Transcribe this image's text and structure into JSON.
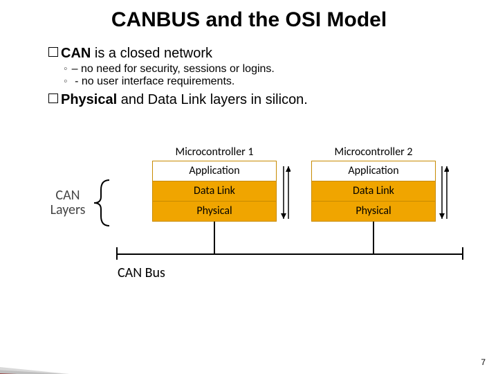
{
  "title": "CANBUS and the OSI Model",
  "bullets": {
    "b1a_prefix": "CAN",
    "b1a_rest": " is a closed network",
    "s1": "– no need for security, sessions or logins.",
    "s2": " - no user interface requirements.",
    "b1b_prefix": "Physical",
    "b1b_rest": " and Data Link layers in silicon."
  },
  "diagram": {
    "mc1": "Microcontroller 1",
    "mc2": "Microcontroller 2",
    "layers": {
      "app": "Application",
      "dl": "Data Link",
      "phy": "Physical"
    },
    "can_layers": "CAN Layers",
    "bus": "CAN Bus"
  },
  "pagenum": "7"
}
